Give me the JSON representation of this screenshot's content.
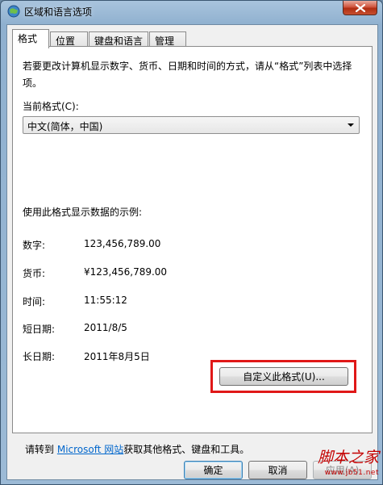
{
  "window": {
    "title": "区域和语言选项",
    "icon": "globe-icon",
    "close_icon": "close-icon"
  },
  "tabs": [
    {
      "label": "格式",
      "active": true
    },
    {
      "label": "位置",
      "active": false
    },
    {
      "label": "键盘和语言",
      "active": false
    },
    {
      "label": "管理",
      "active": false
    }
  ],
  "format_tab": {
    "description": "若要更改计算机显示数字、货币、日期和时间的方式，请从“格式”列表中选择项。",
    "current_format_label": "当前格式(C):",
    "current_format_value": "中文(简体，中国)",
    "sample_title": "使用此格式显示数据的示例:",
    "samples": [
      {
        "label": "数字:",
        "value": "123,456,789.00"
      },
      {
        "label": "货币:",
        "value": "¥123,456,789.00"
      },
      {
        "label": "时间:",
        "value": "11:55:12"
      },
      {
        "label": "短日期:",
        "value": "2011/8/5"
      },
      {
        "label": "长日期:",
        "value": "2011年8月5日"
      }
    ],
    "customize_button": "自定义此格式(U)...",
    "footer_prefix": "请转到",
    "footer_link": "Microsoft 网站",
    "footer_suffix": "获取其他格式、键盘和工具。"
  },
  "buttons": {
    "ok": "确定",
    "cancel": "取消",
    "apply": "应用(A)"
  },
  "watermark": {
    "text": "脚本之家",
    "url": "www.jb51.net"
  },
  "colors": {
    "highlight": "#e01818",
    "link": "#0066cc",
    "watermark": "#c40000"
  }
}
